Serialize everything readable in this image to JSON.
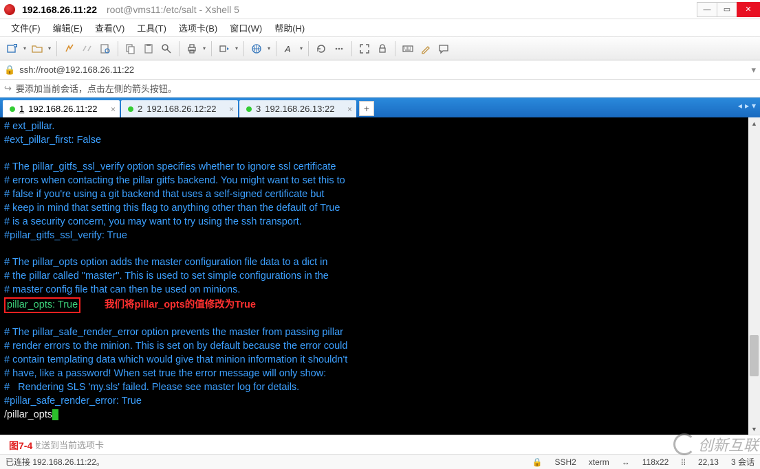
{
  "window": {
    "title_main": "192.168.26.11:22",
    "title_sub": "root@vms11:/etc/salt - Xshell 5"
  },
  "menu": {
    "file": "文件(F)",
    "edit": "编辑(E)",
    "view": "查看(V)",
    "tools": "工具(T)",
    "tabs": "选项卡(B)",
    "window": "窗口(W)",
    "help": "帮助(H)"
  },
  "address": {
    "url": "ssh://root@192.168.26.11:22"
  },
  "infobar": {
    "text": "要添加当前会话，点击左侧的箭头按钮。"
  },
  "tabs": [
    {
      "num": "1",
      "label": "192.168.26.11:22",
      "active": true
    },
    {
      "num": "2",
      "label": "192.168.26.12:22",
      "active": false
    },
    {
      "num": "3",
      "label": "192.168.26.13:22",
      "active": false
    }
  ],
  "terminal": {
    "l1": "# ext_pillar.",
    "l2": "#ext_pillar_first: False",
    "l3": "# The pillar_gitfs_ssl_verify option specifies whether to ignore ssl certificate",
    "l4": "# errors when contacting the pillar gitfs backend. You might want to set this to",
    "l5": "# false if you're using a git backend that uses a self-signed certificate but",
    "l6": "# keep in mind that setting this flag to anything other than the default of True",
    "l7": "# is a security concern, you may want to try using the ssh transport.",
    "l8": "#pillar_gitfs_ssl_verify: True",
    "l9": "# The pillar_opts option adds the master configuration file data to a dict in",
    "l10": "# the pillar called \"master\". This is used to set simple configurations in the",
    "l11": "# master config file that can then be used on minions.",
    "l12": "pillar_opts: True",
    "annotation": "我们将pillar_opts的值修改为True",
    "l13": "# The pillar_safe_render_error option prevents the master from passing pillar",
    "l14": "# render errors to the minion. This is set on by default because the error could",
    "l15": "# contain templating data which would give that minion information it shouldn't",
    "l16": "# have, like a password! When set true the error message will only show:",
    "l17": "#   Rendering SLS 'my.sls' failed. Please see master log for details.",
    "l18": "#pillar_safe_render_error: True",
    "l19": "/pillar_opts"
  },
  "sendbar": {
    "placeholder": "将文本发送到当前选项卡",
    "figlabel": "图7-4"
  },
  "status": {
    "conn": "已连接 192.168.26.11:22。",
    "ssh": "SSH2",
    "term": "xterm",
    "size": "118x22",
    "pos": "22,13",
    "sess": "3 会话"
  },
  "watermark": "创新互联"
}
